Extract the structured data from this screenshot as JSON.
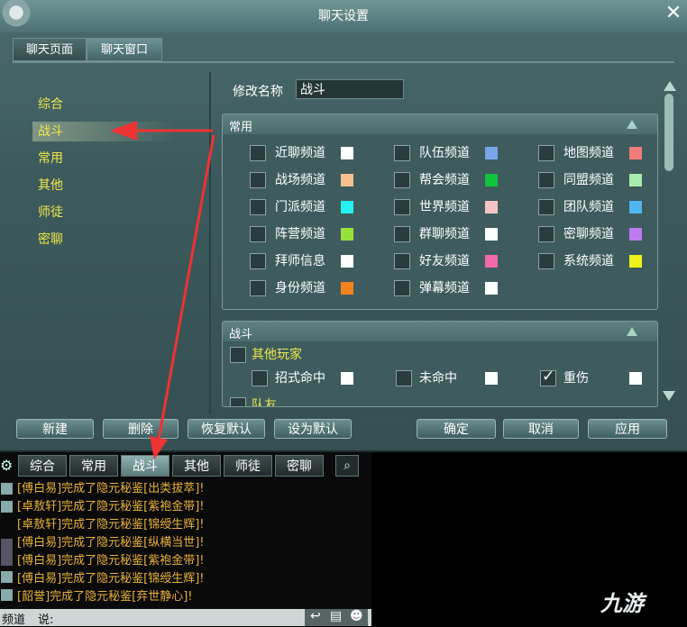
{
  "window": {
    "title": "聊天设置",
    "close_glyph": "✕",
    "tabs": [
      {
        "label": "聊天页面",
        "active": false
      },
      {
        "label": "聊天窗口",
        "active": true
      }
    ]
  },
  "categories": [
    "综合",
    "战斗",
    "常用",
    "其他",
    "师徒",
    "密聊"
  ],
  "selected_category": "战斗",
  "rename": {
    "label": "修改名称",
    "value": "战斗"
  },
  "common_group": {
    "title": "常用",
    "channels": [
      {
        "label": "近聊频道",
        "color": "#ffffff"
      },
      {
        "label": "队伍频道",
        "color": "#7aa5e8"
      },
      {
        "label": "地图频道",
        "color": "#f27b7b"
      },
      {
        "label": "战场频道",
        "color": "#f6c18e"
      },
      {
        "label": "帮会频道",
        "color": "#11c43b"
      },
      {
        "label": "同盟频道",
        "color": "#a8ebad"
      },
      {
        "label": "门派频道",
        "color": "#26f0f0"
      },
      {
        "label": "世界频道",
        "color": "#f6c4c4"
      },
      {
        "label": "团队频道",
        "color": "#4fb6f0"
      },
      {
        "label": "阵营频道",
        "color": "#98e03a"
      },
      {
        "label": "群聊频道",
        "color": "#ffffff"
      },
      {
        "label": "密聊频道",
        "color": "#c07af0"
      },
      {
        "label": "拜师信息",
        "color": "#ffffff"
      },
      {
        "label": "好友频道",
        "color": "#f06aa9"
      },
      {
        "label": "系统频道",
        "color": "#f0f01a"
      },
      {
        "label": "身份频道",
        "color": "#f58220"
      },
      {
        "label": "弹幕频道",
        "color": "#ffffff"
      }
    ]
  },
  "battle_group": {
    "title": "战斗",
    "other_players_label": "其他玩家",
    "items": [
      {
        "label": "招式命中",
        "color": "#ffffff",
        "checked": false
      },
      {
        "label": "未命中",
        "color": "#ffffff",
        "checked": false
      },
      {
        "label": "重伤",
        "color": "#ffffff",
        "checked": true
      }
    ],
    "team_label": "队友"
  },
  "buttons": {
    "new": "新建",
    "delete": "删除",
    "restore": "恢复默认",
    "set_default": "设为默认",
    "ok": "确定",
    "cancel": "取消",
    "apply": "应用"
  },
  "chat": {
    "tabs": [
      "综合",
      "常用",
      "战斗",
      "其他",
      "师徒",
      "密聊"
    ],
    "active_tab": "战斗",
    "messages": [
      "[傅白易]完成了隐元秘鉴[出类拔萃]!",
      "[卓敖轩]完成了隐元秘鉴[紫袍金带]!",
      "[卓敖轩]完成了隐元秘鉴[锦绶生辉]!",
      "[傅白易]完成了隐元秘鉴[纵横当世]!",
      "[傅白易]完成了隐元秘鉴[紫袍金带]!",
      "[傅白易]完成了隐元秘鉴[锦绶生辉]!",
      "[韶誉]完成了隐元秘鉴[弃世静心]!"
    ],
    "channel_label": "频道",
    "say_label": "说:"
  },
  "watermark": "九游"
}
